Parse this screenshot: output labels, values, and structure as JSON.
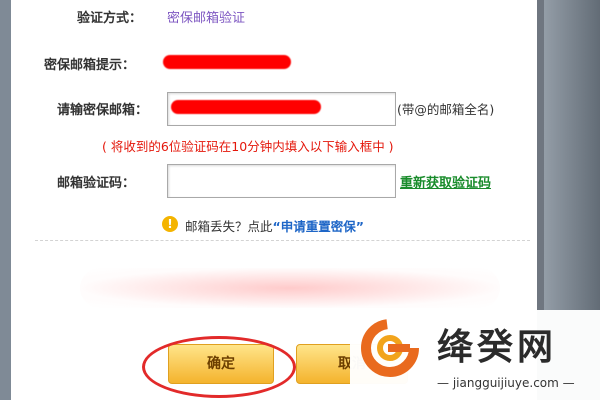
{
  "form": {
    "verify_method": {
      "label": "验证方式：",
      "value": "密保邮箱验证"
    },
    "email_hint": {
      "label": "密保邮箱提示："
    },
    "email_input": {
      "label": "请输密保邮箱：",
      "hint": "(带@的邮箱全名)"
    },
    "notice": "( 将收到的6位验证码在10分钟内填入以下输入框中 )",
    "code_input": {
      "label": "邮箱验证码：",
      "resend_link": "重新获取验证码"
    },
    "lost": {
      "prefix": "邮箱丢失？点此",
      "link": "“申请重置密保”"
    },
    "buttons": {
      "confirm": "确定",
      "cancel": "取消"
    }
  },
  "watermark": {
    "title": "绛癸网",
    "subtitle": "jiangguijiuye.com"
  },
  "colors": {
    "accent_purple": "#7e57c2",
    "notice_red": "#e4170b",
    "link_green": "#1a8c2c",
    "link_blue": "#1e66c7",
    "button_yellow": "#f4b32d",
    "annotation_red": "#e22a2a"
  },
  "icons": {
    "info": "info-icon",
    "watermark_logo": "g-logo-icon"
  }
}
